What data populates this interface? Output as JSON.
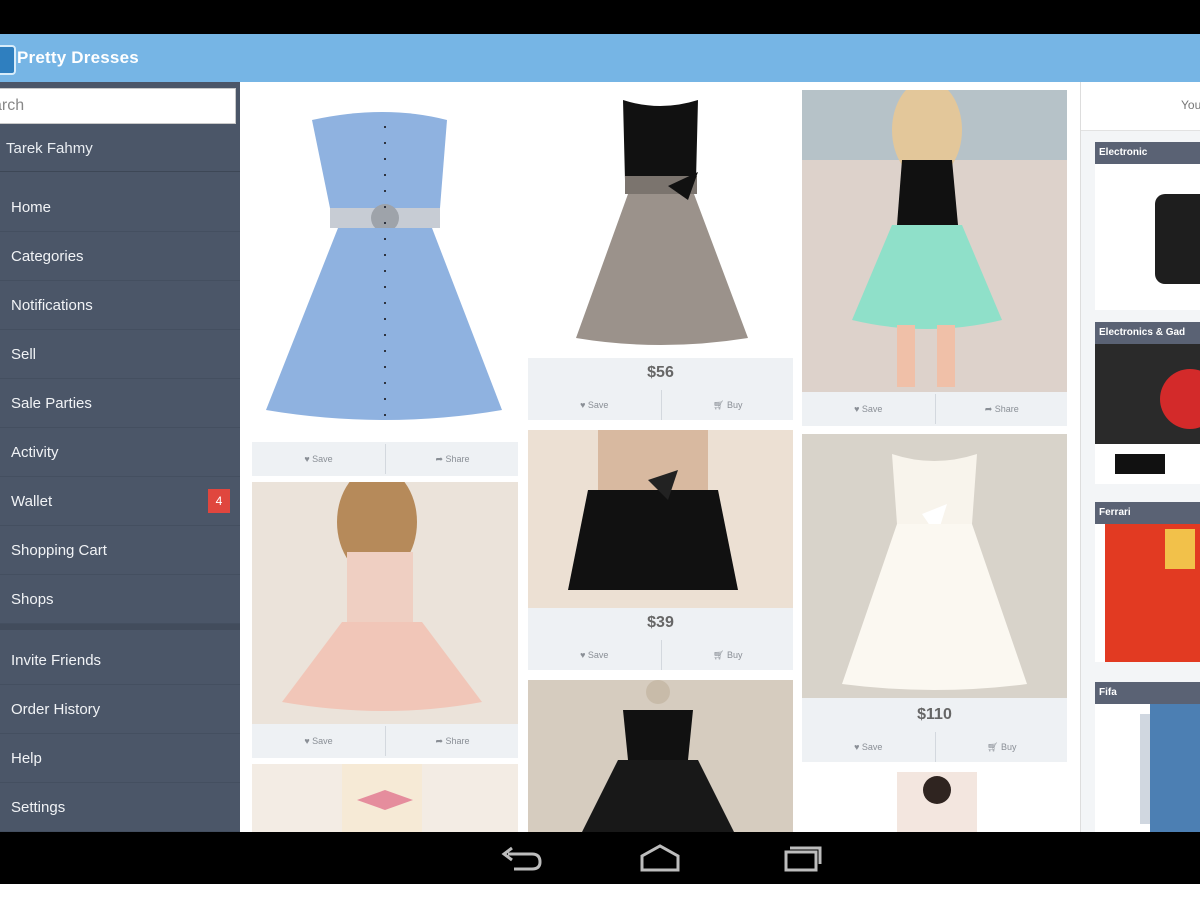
{
  "app": {
    "title": "Pretty Dresses"
  },
  "drawer": {
    "search_placeholder": "Search",
    "search_visible_text": "arch",
    "user_name": "Tarek Fahmy",
    "items": [
      {
        "label": "Home"
      },
      {
        "label": "Categories"
      },
      {
        "label": "Notifications"
      },
      {
        "label": "Sell"
      },
      {
        "label": "Sale Parties"
      },
      {
        "label": "Activity"
      },
      {
        "label": "Wallet",
        "badge": "4"
      },
      {
        "label": "Shopping Cart"
      },
      {
        "label": "Shops"
      },
      {
        "label": "Invite Friends"
      },
      {
        "label": "Order History"
      },
      {
        "label": "Help"
      },
      {
        "label": "Settings"
      }
    ]
  },
  "feed": {
    "actions": {
      "save": "Save",
      "share": "Share",
      "buy": "Buy"
    },
    "cards": [
      {
        "image": "blue strapless dress with black buttons",
        "price": ""
      },
      {
        "image": "black and grey tulle dress with bow",
        "price": "$56"
      },
      {
        "image": "model in mint skirt with black top",
        "price": ""
      },
      {
        "image": "pink ruffle strapless dress",
        "price": ""
      },
      {
        "image": "black tutu skirt with bow",
        "price": "$39"
      },
      {
        "image": "white tulle dress with bow",
        "price": "$110"
      },
      {
        "image": "black strapless dress on mannequin",
        "price": ""
      },
      {
        "image": "cream dress with pink bow",
        "price": ""
      },
      {
        "image": "woman in pink dress",
        "price": ""
      }
    ]
  },
  "rightcol": {
    "header": "You",
    "cards": [
      {
        "label": "Electronic"
      },
      {
        "label": "Electronics & Gad"
      },
      {
        "label": "Ferrari"
      },
      {
        "label": "Fifa"
      }
    ]
  },
  "colors": {
    "action_bar": "#76b5e5",
    "drawer": "#4b5668",
    "badge": "#e0463e",
    "card_bg": "#eef1f4"
  },
  "icons": [
    "heart-icon",
    "share-icon",
    "cart-icon",
    "back-icon",
    "home-icon",
    "recents-icon"
  ]
}
